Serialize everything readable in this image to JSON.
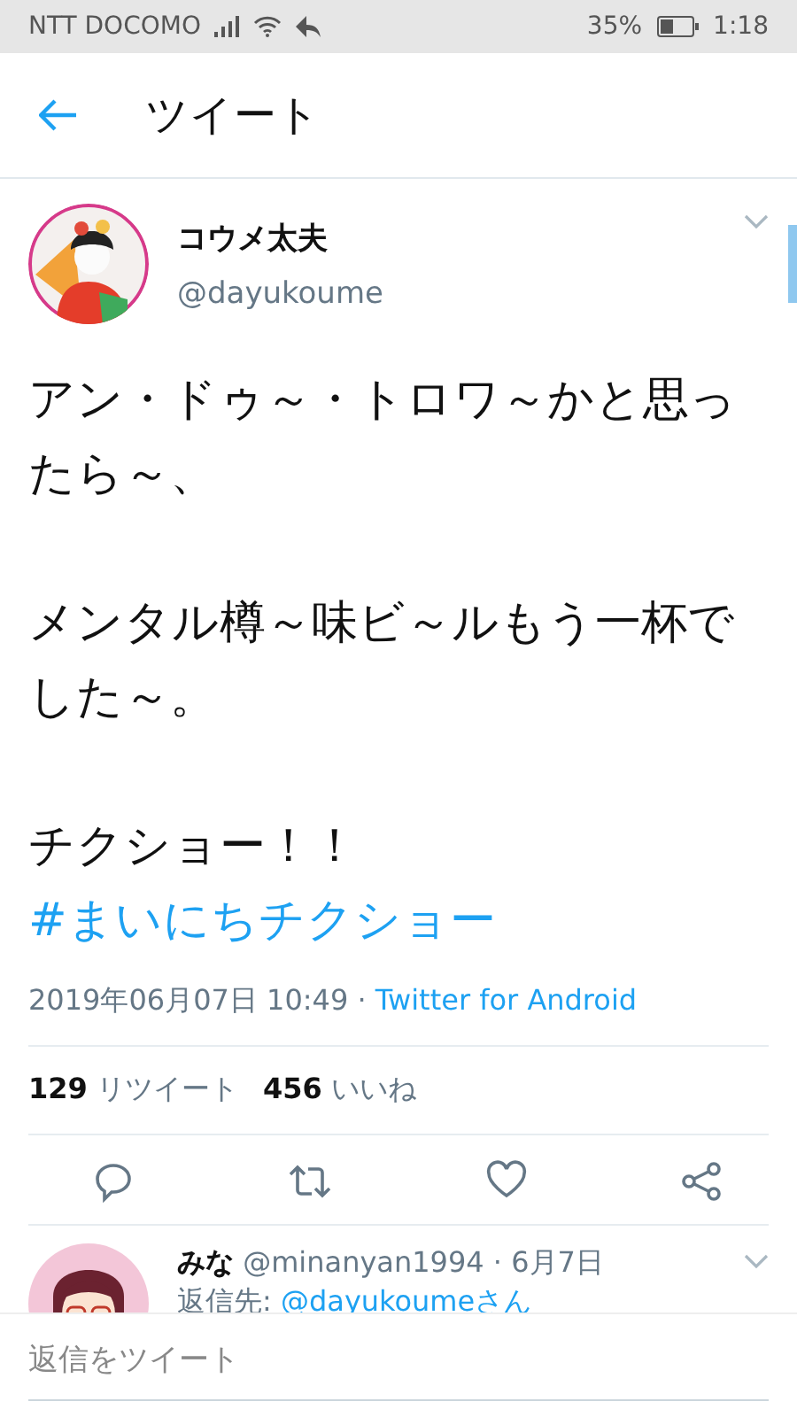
{
  "status_bar": {
    "carrier": "NTT DOCOMO",
    "battery": "35%",
    "time": "1:18"
  },
  "header": {
    "title": "ツイート"
  },
  "tweet": {
    "name": "コウメ太夫",
    "handle": "@dayukoume",
    "paragraphs": [
      {
        "text": "アン・ドゥ～・トロワ～かと思ったら～、"
      },
      {
        "text": "メンタル樽～味ビ～ルもう一杯でした～。"
      },
      {
        "text": "チクショー！！　",
        "hashtag": "#まいにちチクショー"
      }
    ],
    "date": "2019年06月07日 10:49 · ",
    "source": "Twitter for Android",
    "retweets": "129",
    "retweets_label": "リツイート",
    "likes": "456",
    "likes_label": "いいね"
  },
  "reply": {
    "name": "みな",
    "handle_date": "@minanyan1994 · 6月7日",
    "reply_to_label": "返信先: ",
    "reply_to": "@dayukoumeさん"
  },
  "compose": {
    "placeholder": "返信をツイート"
  }
}
